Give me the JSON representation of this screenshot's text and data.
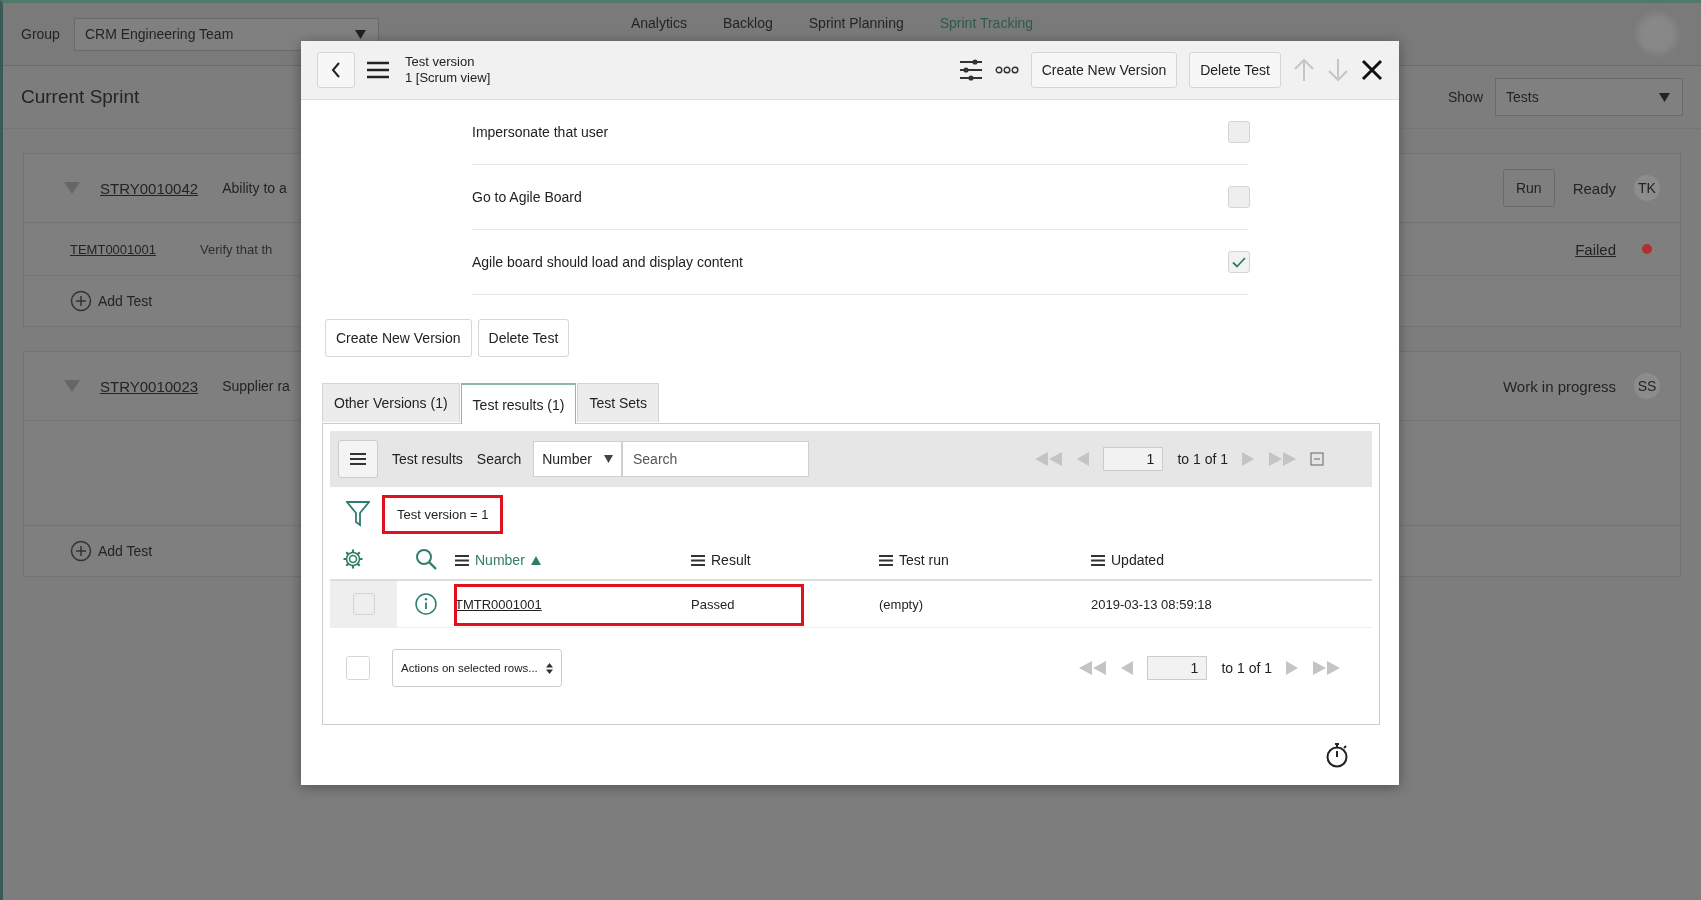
{
  "header": {
    "group_label": "Group",
    "group_value": "CRM Engineering Team",
    "nav": [
      {
        "label": "Analytics",
        "selected": false
      },
      {
        "label": "Backlog",
        "selected": false
      },
      {
        "label": "Sprint Planning",
        "selected": false
      },
      {
        "label": "Sprint Tracking",
        "selected": true
      }
    ]
  },
  "sprint": {
    "title": "Current Sprint",
    "show_label": "Show",
    "show_value": "Tests"
  },
  "stories": [
    {
      "number": "STRY0010042",
      "title": "Ability to a",
      "run_button": "Run",
      "state": "Ready",
      "assignee": "TK",
      "tests": [
        {
          "number": "TEMT0001001",
          "title": "Verify that th",
          "result": "Failed",
          "color": "#b03030"
        }
      ],
      "add_test": "Add Test"
    },
    {
      "number": "STRY0010023",
      "title": "Supplier ra",
      "state": "Work in progress",
      "assignee": "SS",
      "add_test": "Add Test"
    }
  ],
  "modal": {
    "title": "Test version",
    "subtitle": "1 [Scrum view]",
    "header_buttons": [
      "Create New Version",
      "Delete Test"
    ],
    "steps": [
      {
        "label": "Impersonate that user",
        "checked": false
      },
      {
        "label": "Go to Agile Board",
        "checked": false
      },
      {
        "label": "Agile board should load and display content",
        "checked": true
      }
    ],
    "buttons": [
      "Create New Version",
      "Delete Test"
    ],
    "tabs": [
      {
        "label": "Other Versions (1)",
        "selected": false
      },
      {
        "label": "Test results (1)",
        "selected": true
      },
      {
        "label": "Test Sets",
        "selected": false
      }
    ],
    "list": {
      "title": "Test results",
      "search_label": "Search",
      "search_field": "Number",
      "search_placeholder": "Search",
      "page": "1",
      "page_total": "to 1 of 1",
      "filter": "Test version = 1",
      "filter_highlighted": true,
      "columns": [
        {
          "label": "Number",
          "sorted": true
        },
        {
          "label": "Result",
          "sorted": false
        },
        {
          "label": "Test run",
          "sorted": false
        },
        {
          "label": "Updated",
          "sorted": false
        }
      ],
      "rows": [
        {
          "number": "TMTR0001001",
          "result": "Passed",
          "test_run": "(empty)",
          "updated": "2019-03-13 08:59:18",
          "selected": false,
          "highlighted": true
        }
      ],
      "all_selected": false,
      "actions": "Actions on selected rows...",
      "footer_page": "1",
      "footer_total": "to 1 of 1"
    }
  }
}
